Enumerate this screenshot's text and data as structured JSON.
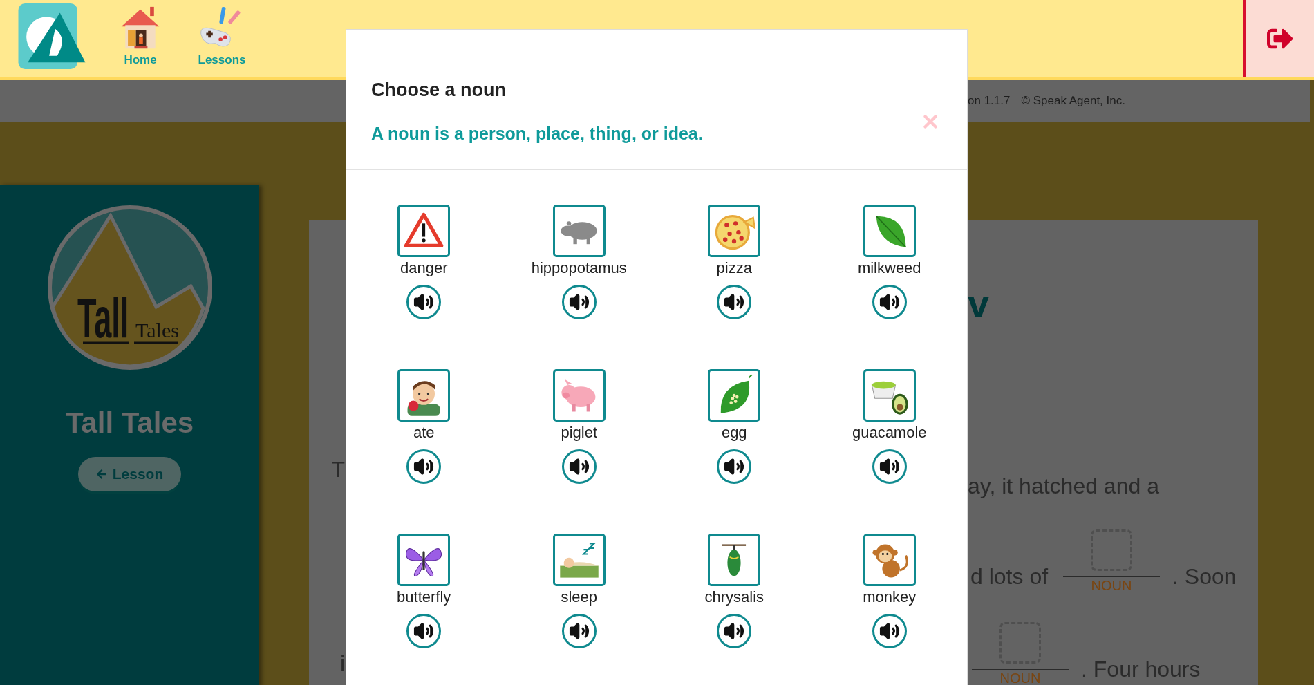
{
  "header": {
    "nav": [
      {
        "label": "Home",
        "kind": "home"
      },
      {
        "label": "Lessons",
        "kind": "lessons"
      }
    ]
  },
  "status_bar": {
    "version": "on 1.1.7",
    "copyright": "© Speak Agent, Inc."
  },
  "sidebar": {
    "logo_words": [
      "Tall",
      "Tales"
    ],
    "title": "Tall Tales",
    "back_button": "Lesson"
  },
  "story": {
    "heading_fragment": "v",
    "left_fragments": [
      "T",
      "i"
    ],
    "line_1": "ay, it hatched and a",
    "line_2": {
      "before": "d lots of",
      "blank_label": "NOUN",
      "after": ". Soon"
    },
    "line_3": {
      "blank_label": "NOUN",
      "after": ". Four hours"
    }
  },
  "dialog": {
    "title": "Choose a noun",
    "hint": "A noun is a person, place, thing, or idea.",
    "words": [
      {
        "word": "danger"
      },
      {
        "word": "hippopotamus"
      },
      {
        "word": "pizza"
      },
      {
        "word": "milkweed"
      },
      {
        "word": "ate"
      },
      {
        "word": "piglet"
      },
      {
        "word": "egg"
      },
      {
        "word": "guacamole"
      },
      {
        "word": "butterfly"
      },
      {
        "word": "sleep"
      },
      {
        "word": "chrysalis"
      },
      {
        "word": "monkey"
      }
    ]
  }
}
